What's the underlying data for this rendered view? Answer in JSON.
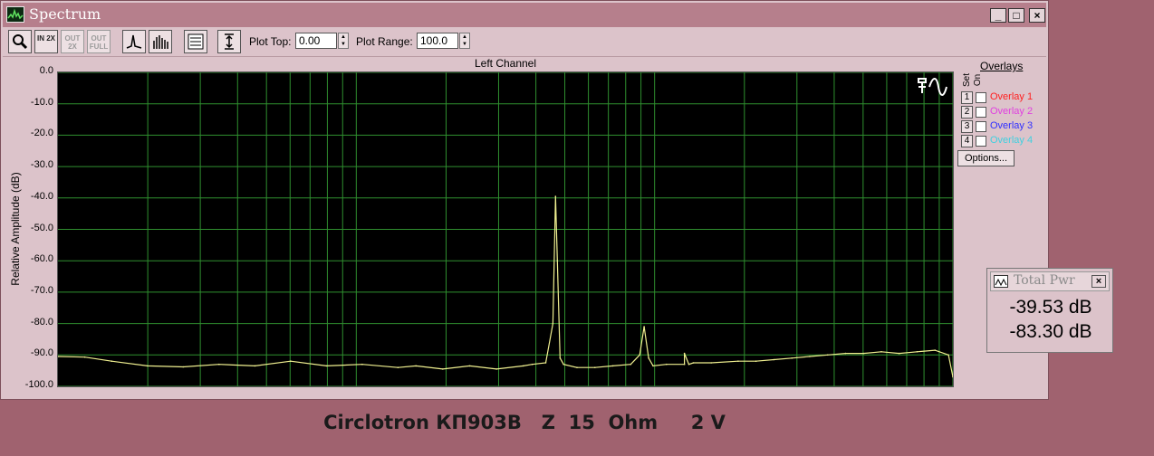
{
  "window": {
    "title": "Spectrum",
    "buttons": {
      "minimize": "_",
      "maximize": "□",
      "close": "×"
    }
  },
  "toolbar": {
    "tools": [
      {
        "name": "zoom",
        "icon": "magnifier-icon",
        "enabled": true
      },
      {
        "name": "zoom-in-2x",
        "label": "IN 2X",
        "enabled": true
      },
      {
        "name": "zoom-out-2x",
        "label": "OUT 2X",
        "enabled": false
      },
      {
        "name": "zoom-out-full",
        "label": "OUT FULL",
        "enabled": false
      },
      {
        "name": "line-mode",
        "icon": "line-spectrum-icon",
        "enabled": true
      },
      {
        "name": "bar-mode",
        "icon": "bar-spectrum-icon",
        "enabled": true
      },
      {
        "name": "settings",
        "icon": "form-icon",
        "enabled": true
      },
      {
        "name": "autoscale",
        "icon": "vertical-range-icon",
        "enabled": true
      }
    ],
    "plot_top_label": "Plot Top:",
    "plot_top_value": "0.00",
    "plot_range_label": "Plot Range:",
    "plot_range_value": "100.0"
  },
  "channel_label": "Left Channel",
  "overlays": {
    "title": "Overlays",
    "set_label": "Set",
    "on_label": "On",
    "items": [
      {
        "num": "1",
        "label": "Overlay 1",
        "color": "#ff2020",
        "checked": false
      },
      {
        "num": "2",
        "label": "Overlay 2",
        "color": "#e040e0",
        "checked": false
      },
      {
        "num": "3",
        "label": "Overlay 3",
        "color": "#3030ff",
        "checked": false
      },
      {
        "num": "4",
        "label": "Overlay 4",
        "color": "#40d0e0",
        "checked": false
      }
    ],
    "options_button": "Options..."
  },
  "total_power": {
    "title": "Total Pwr",
    "value1": "-39.53 dB",
    "value2": "-83.30 dB"
  },
  "caption": "Circlotron КП903В   Z  15  Ohm     2 V",
  "chart_data": {
    "type": "line",
    "title": "Left Channel",
    "ylabel": "Relative Amplitude (dB)",
    "xlabel": "",
    "ylim": [
      -100,
      0
    ],
    "y_ticks": [
      "0.0",
      "-10.0",
      "-20.0",
      "-30.0",
      "-40.0",
      "-50.0",
      "-60.0",
      "-70.0",
      "-80.0",
      "-90.0",
      "-100.0"
    ],
    "x_scale": "log",
    "x_range_decades": 3,
    "grid": true,
    "line_color": "#f0f090",
    "background": "#000000",
    "grid_color": "#2f8f2f",
    "series": [
      {
        "x": [
          0.0,
          0.03,
          0.06,
          0.1,
          0.14,
          0.18,
          0.22,
          0.26,
          0.3,
          0.34,
          0.38,
          0.4,
          0.43,
          0.46,
          0.49,
          0.52,
          0.53,
          0.545,
          0.553,
          0.556,
          0.558,
          0.561,
          0.565,
          0.58,
          0.6,
          0.62,
          0.64,
          0.65,
          0.655,
          0.66,
          0.665,
          0.68,
          0.7,
          0.7,
          0.705,
          0.71,
          0.73,
          0.76,
          0.78,
          0.8,
          0.82,
          0.84,
          0.86,
          0.88,
          0.9,
          0.92,
          0.94,
          0.96,
          0.98,
          0.995,
          1.0
        ],
        "y": [
          -90.5,
          -90.7,
          -92,
          -93.5,
          -93.8,
          -93,
          -93.5,
          -92,
          -93.5,
          -93,
          -94,
          -93.5,
          -94.5,
          -93.5,
          -94.5,
          -93.5,
          -93,
          -92.5,
          -80,
          -39.5,
          -60,
          -91,
          -93,
          -94,
          -94,
          -93.5,
          -93,
          -90,
          -81,
          -91,
          -93.5,
          -93,
          -93,
          -89.5,
          -93,
          -92.5,
          -92.5,
          -92,
          -92,
          -91.5,
          -91,
          -90.5,
          -90,
          -89.5,
          -89.5,
          -89,
          -89.5,
          -89,
          -88.5,
          -90,
          -97
        ]
      }
    ]
  }
}
